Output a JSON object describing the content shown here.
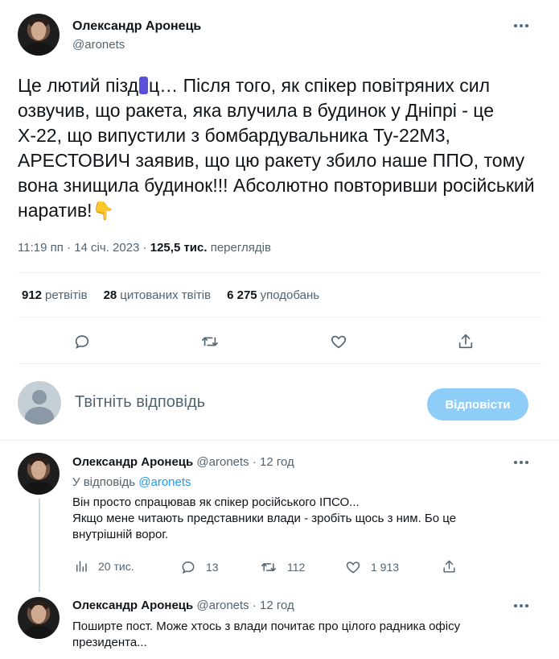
{
  "tweet": {
    "author_name": "Олександр Аронець",
    "author_handle": "@aronets",
    "text_before_redaction": "Це лютий пізд",
    "text_after_redaction": "ц… Після того, як спікер повітряних сил озвучив, що ракета, яка влучила в будинок у Дніпрі - це Х-22, що випустили з бомбардувальника Ту-22М3, АРЕСТОВИЧ заявив, що цю ракету збило наше ППО, тому вона знищила будинок!!! Абсолютно повторивши російський наратив!",
    "emoji": "👇",
    "time": "11:19 пп",
    "date": "14 січ. 2023",
    "views_count": "125,5 тис.",
    "views_label": "переглядів",
    "separator": "·"
  },
  "stats": {
    "retweets_count": "912",
    "retweets_label": "ретвітів",
    "quotes_count": "28",
    "quotes_label": "цитованих твітів",
    "likes_count": "6 275",
    "likes_label": "уподобань"
  },
  "composer": {
    "placeholder": "Твітніть відповідь",
    "button_label": "Відповісти",
    "button_color": "#8ecdf8"
  },
  "replies": [
    {
      "author_name": "Олександр Аронець",
      "author_handle": "@aronets",
      "age": "12 год",
      "in_reply_prefix": "У відповідь",
      "in_reply_handle": "@aronets",
      "text_lines": [
        "Він просто спрацював як спікер російського ІПСО...",
        "Якщо мене читають представники влади - зробіть щось з ним. Бо це",
        "внутрішній ворог."
      ],
      "views": "20 тис.",
      "replies_count": "13",
      "retweets_count": "112",
      "likes_count": "1 913"
    },
    {
      "author_name": "Олександр Аронець",
      "author_handle": "@aronets",
      "age": "12 год",
      "text_lines": [
        "Поширте пост. Може хтось з влади почитає про цілого радника офісу",
        "президента..."
      ]
    }
  ],
  "colors": {
    "accent": "#1d9bf0",
    "text": "#0f1419",
    "secondary": "#536471",
    "redaction": "#5b50d9"
  },
  "icons": [
    "more-icon",
    "reply-icon",
    "retweet-icon",
    "like-icon",
    "share-icon",
    "views-icon"
  ]
}
